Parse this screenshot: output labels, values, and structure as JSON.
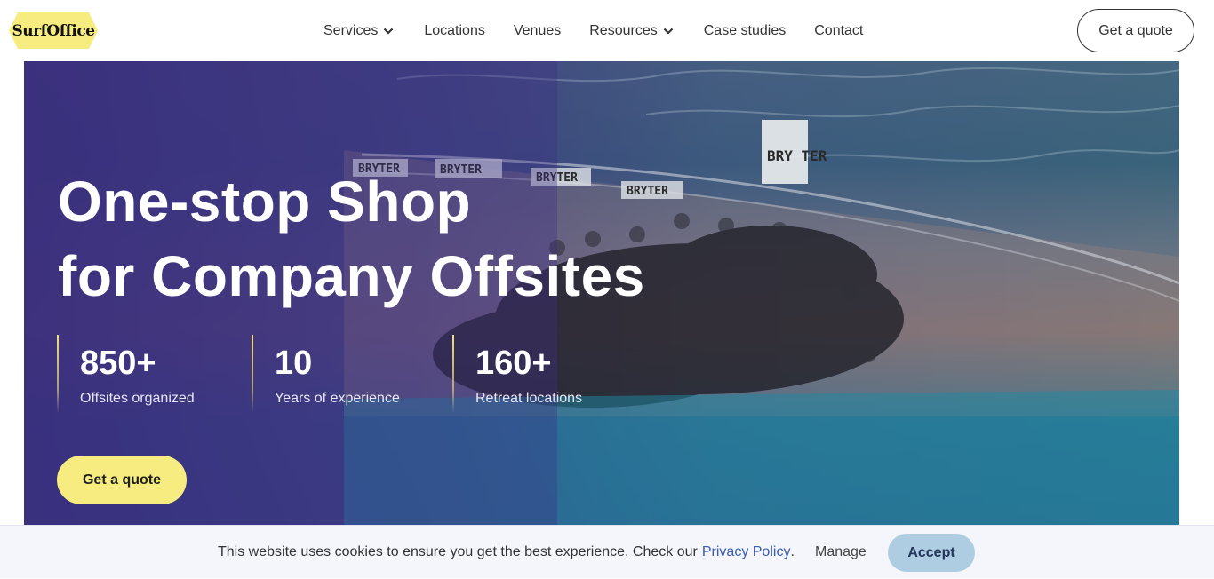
{
  "brand": {
    "name": "SurfOffice",
    "logo_color": "#f6ec7f"
  },
  "nav": {
    "items": [
      {
        "label": "Services",
        "dropdown": true
      },
      {
        "label": "Locations",
        "dropdown": false
      },
      {
        "label": "Venues",
        "dropdown": false
      },
      {
        "label": "Resources",
        "dropdown": true
      },
      {
        "label": "Case studies",
        "dropdown": false
      },
      {
        "label": "Contact",
        "dropdown": false
      }
    ],
    "quote_button": "Get a quote"
  },
  "hero": {
    "title_line1": "One-stop Shop",
    "title_line2": "for Company Offsites",
    "photo_signs": [
      "BRYTER",
      "BRYTER",
      "BRYTER",
      "BRYTER",
      "BRY TER"
    ],
    "stats": [
      {
        "value": "850+",
        "label": "Offsites organized"
      },
      {
        "value": "10",
        "label": "Years of experience"
      },
      {
        "value": "160+",
        "label": "Retreat locations"
      }
    ],
    "cta": "Get a quote",
    "accent_color": "#f6ec7f"
  },
  "cookie_bar": {
    "text": "This website uses cookies to ensure you get the best experience. Check our",
    "link": "Privacy Policy",
    "period": ".",
    "manage": "Manage",
    "accept": "Accept"
  }
}
